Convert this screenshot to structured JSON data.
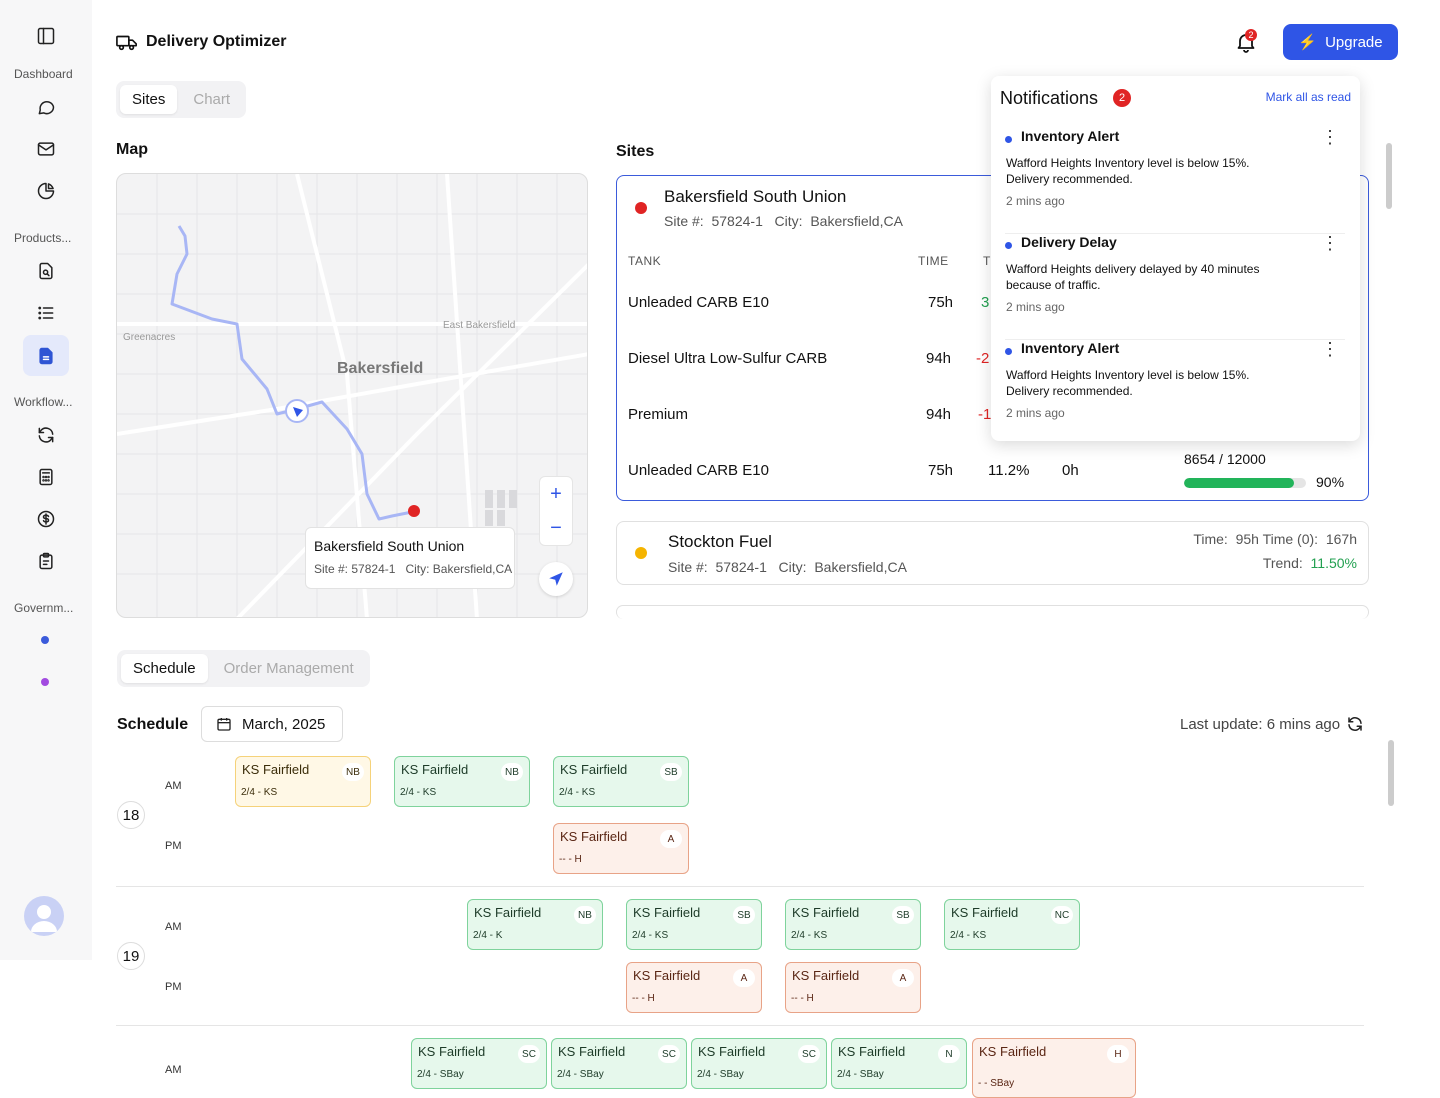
{
  "app": {
    "title": "Delivery Optimizer",
    "upgrade_label": "Upgrade",
    "notification_count": "2"
  },
  "sidebar": {
    "sections": [
      "Dashboard",
      "Products...",
      "Workflow...",
      "Governm..."
    ]
  },
  "top_tabs": [
    "Sites",
    "Chart"
  ],
  "map": {
    "title": "Map",
    "labels": {
      "city": "Bakersfield",
      "west": "Greenacres",
      "east": "East Bakersfield"
    },
    "popup": {
      "name": "Bakersfield South Union",
      "site_label": "Site #:",
      "site_no": "57824-1",
      "city_label": "City:",
      "city": "Bakersfield,CA"
    }
  },
  "sites": {
    "title": "Sites",
    "main": {
      "name": "Bakersfield South Union",
      "site_label": "Site #:",
      "site_no": "57824-1",
      "city_label": "City:",
      "city": "Bakersfield,CA",
      "headers": [
        "TANK",
        "TIME",
        "T"
      ],
      "rows": [
        {
          "tank": "Unleaded CARB E10",
          "time": "75h",
          "trend": "3"
        },
        {
          "tank": "Diesel Ultra Low-Sulfur CARB",
          "time": "94h",
          "trend": "-2"
        },
        {
          "tank": "Premium",
          "time": "94h",
          "trend": "-1"
        },
        {
          "tank": "Unleaded CARB E10",
          "time": "75h",
          "trend": "11.2%",
          "time0": "0h",
          "volume": "8654 / 12000",
          "percent": "90%",
          "fill": 0.9
        }
      ]
    },
    "second": {
      "name": "Stockton Fuel",
      "site_label": "Site #:",
      "site_no": "57824-1",
      "city_label": "City:",
      "city": "Bakersfield,CA",
      "time_label": "Time:",
      "time": "95h",
      "time0_label": "Time (0):",
      "time0": "167h",
      "trend_label": "Trend:",
      "trend": "11.50%"
    }
  },
  "notifications": {
    "title": "Notifications",
    "count": "2",
    "mark_all": "Mark all as read",
    "items": [
      {
        "title": "Inventory Alert",
        "body1": "Wafford Heights Inventory level is below 15%.",
        "body2": "Delivery recommended.",
        "time": "2 mins ago"
      },
      {
        "title": "Delivery Delay",
        "body1": "Wafford Heights delivery delayed by 40 minutes",
        "body2": "because of traffic.",
        "time": "2 mins ago"
      },
      {
        "title": "Inventory Alert",
        "body1": "Wafford Heights Inventory level is below 15%.",
        "body2": "Delivery recommended.",
        "time": "2 mins ago"
      }
    ]
  },
  "schedule_tabs": [
    "Schedule",
    "Order Management"
  ],
  "schedule": {
    "title": "Schedule",
    "month": "March, 2025",
    "last_update": "Last update: 6 mins ago",
    "am": "AM",
    "pm": "PM",
    "days": [
      "18",
      "19"
    ],
    "events": [
      {
        "name": "KS Fairfield",
        "code": "NB",
        "sub": "2/4 - KS",
        "color": "yellow"
      },
      {
        "name": "KS Fairfield",
        "code": "NB",
        "sub": "2/4 - KS",
        "color": "green"
      },
      {
        "name": "KS Fairfield",
        "code": "SB",
        "sub": "2/4 - KS",
        "color": "green"
      },
      {
        "name": "KS Fairfield",
        "code": "A",
        "sub": "-- - H",
        "color": "orange"
      },
      {
        "name": "KS Fairfield",
        "code": "NB",
        "sub": "2/4 - K",
        "color": "green"
      },
      {
        "name": "KS Fairfield",
        "code": "SB",
        "sub": "2/4 - KS",
        "color": "green"
      },
      {
        "name": "KS Fairfield",
        "code": "SB",
        "sub": "2/4 - KS",
        "color": "green"
      },
      {
        "name": "KS Fairfield",
        "code": "NC",
        "sub": "2/4 - KS",
        "color": "green"
      },
      {
        "name": "KS Fairfield",
        "code": "A",
        "sub": "-- - H",
        "color": "orange"
      },
      {
        "name": "KS Fairfield",
        "code": "A",
        "sub": "-- - H",
        "color": "orange"
      },
      {
        "name": "KS Fairfield",
        "code": "SC",
        "sub": "2/4 - SBay",
        "color": "green"
      },
      {
        "name": "KS Fairfield",
        "code": "SC",
        "sub": "2/4 - SBay",
        "color": "green"
      },
      {
        "name": "KS Fairfield",
        "code": "SC",
        "sub": "2/4 - SBay",
        "color": "green"
      },
      {
        "name": "KS Fairfield",
        "code": "N",
        "sub": "2/4 - SBay",
        "color": "green"
      },
      {
        "name": "KS Fairfield",
        "code": "H",
        "sub": "- - SBay",
        "color": "orange"
      }
    ]
  }
}
